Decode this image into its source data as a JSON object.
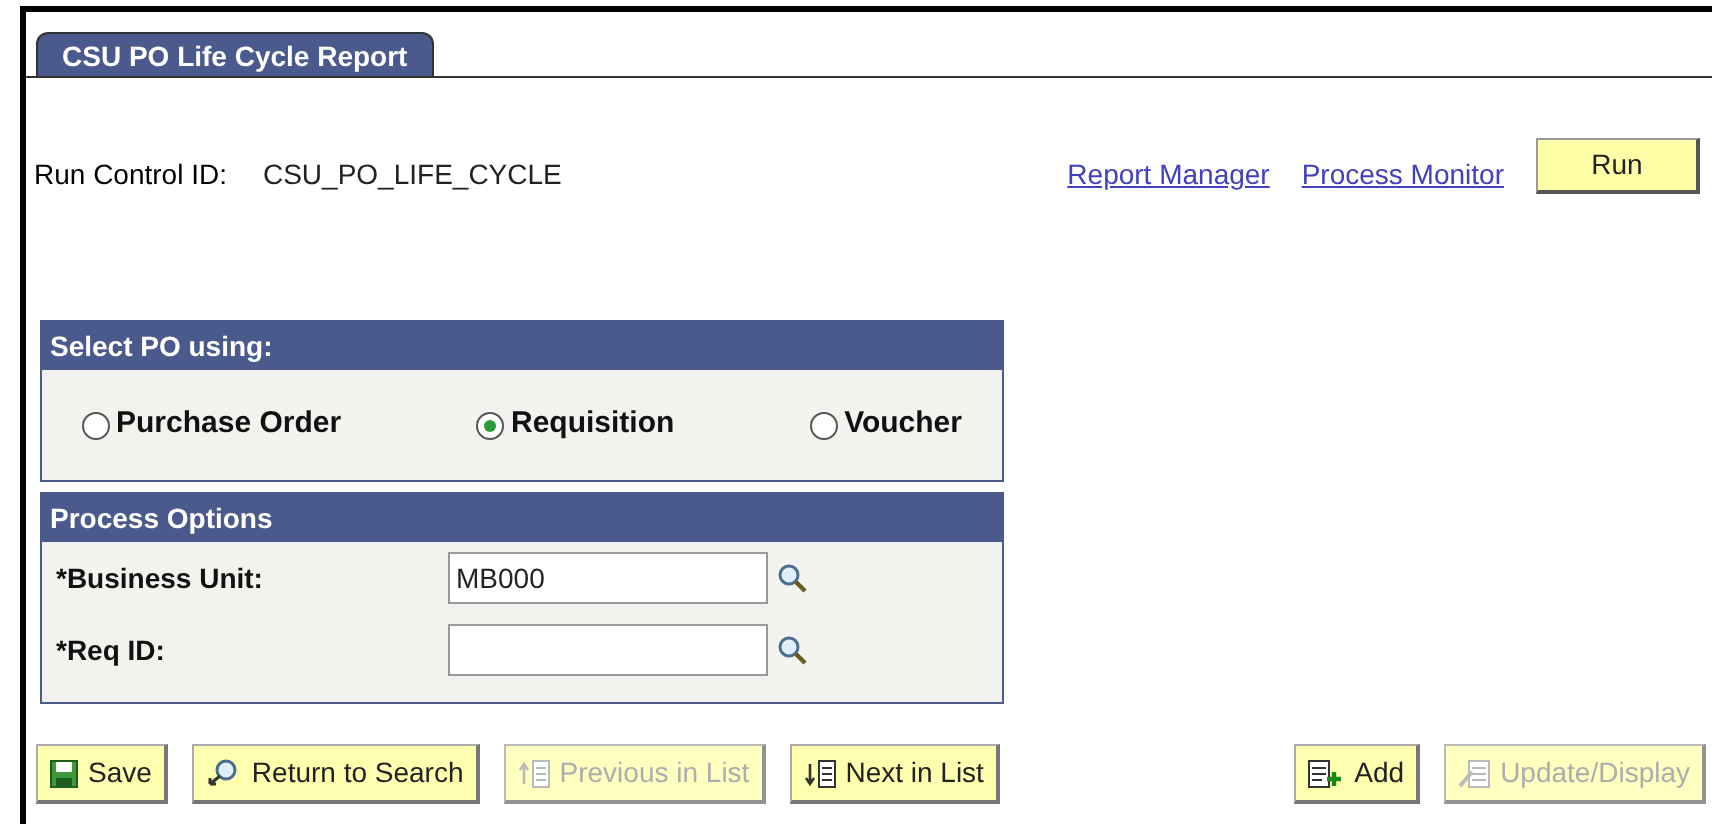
{
  "tab": {
    "label": "CSU PO Life Cycle Report",
    "selected": true
  },
  "run_control": {
    "label": "Run Control ID:",
    "value": "CSU_PO_LIFE_CYCLE"
  },
  "links": [
    "Report Manager",
    "Process Monitor"
  ],
  "run_button": "Run",
  "select_po": {
    "title": "Select PO using:",
    "options": [
      {
        "label": "Purchase Order",
        "selected": false
      },
      {
        "label": "Requisition",
        "selected": true
      },
      {
        "label": "Voucher",
        "selected": false
      }
    ]
  },
  "process_options": {
    "title": "Process Options",
    "fields": [
      {
        "label": "*Business Unit:",
        "value": "MB000"
      },
      {
        "label": "*Req ID:"
      }
    ]
  },
  "toolbar": [
    {
      "kind": "save",
      "label": "Save",
      "disabled": false
    },
    {
      "kind": "search",
      "label": "Return to Search",
      "disabled": false
    },
    {
      "kind": "previous",
      "label": "Previous in List",
      "disabled": true
    },
    {
      "kind": "next",
      "label": "Next in List",
      "disabled": false
    },
    {
      "kind": "add",
      "label": "Add",
      "disabled": false
    },
    {
      "kind": "update",
      "label": "Update/Display",
      "disabled": true
    }
  ]
}
